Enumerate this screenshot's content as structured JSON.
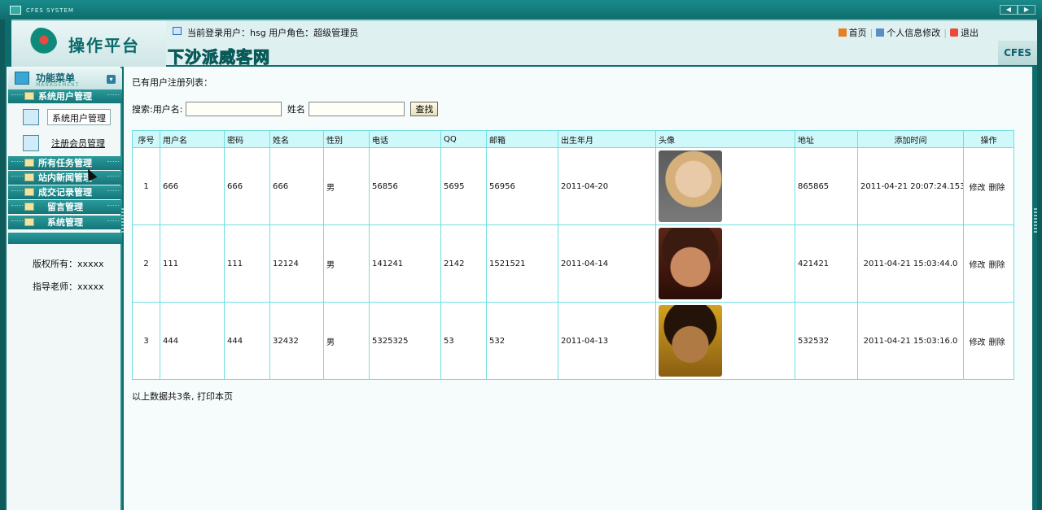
{
  "window": {
    "app_title": "CFES SYSTEM",
    "nav_prev": "◀",
    "nav_next": "▶"
  },
  "header": {
    "logo_text": "操作平台",
    "site_name": "下沙派威客网",
    "user_info": "当前登录用户：hsg  用户角色：超级管理员",
    "links": {
      "home": "首页",
      "profile": "个人信息修改",
      "logout": "退出"
    },
    "badge": "CFES"
  },
  "sidebar": {
    "menu_title": "功能菜单",
    "menu_subtitle": "MANAGEMENT",
    "collapse_glyph": "▾",
    "items": [
      {
        "label": "系统用户管理"
      },
      {
        "label": "所有任务管理"
      },
      {
        "label": "站内新闻管理"
      },
      {
        "label": "成交记录管理"
      },
      {
        "label": "留言管理"
      },
      {
        "label": "系统管理"
      }
    ],
    "sub_items": [
      {
        "label": "系统用户管理"
      },
      {
        "label": "注册会员管理"
      }
    ],
    "copyright": "版权所有：xxxxx",
    "teacher": "指导老师：xxxxx"
  },
  "main": {
    "heading": "已有用户注册列表：",
    "search": {
      "username_label": "搜索:用户名:",
      "username_value": "",
      "name_label": "姓名",
      "name_value": "",
      "button": "查找"
    },
    "table": {
      "headers": [
        "序号",
        "用户名",
        "密码",
        "姓名",
        "性别",
        "电话",
        "QQ",
        "邮箱",
        "出生年月",
        "头像",
        "地址",
        "添加时间",
        "操作"
      ],
      "rows": [
        {
          "no": "1",
          "username": "666",
          "password": "666",
          "name": "666",
          "gender": "男",
          "phone": "56856",
          "qq": "5695",
          "email": "56956",
          "birth": "2011-04-20",
          "address": "865865",
          "added": "2011-04-21 20:07:24.153",
          "edit": "修改",
          "delete": "删除"
        },
        {
          "no": "2",
          "username": "111",
          "password": "111",
          "name": "12124",
          "gender": "男",
          "phone": "141241",
          "qq": "2142",
          "email": "1521521",
          "birth": "2011-04-14",
          "address": "421421",
          "added": "2011-04-21 15:03:44.0",
          "edit": "修改",
          "delete": "删除"
        },
        {
          "no": "3",
          "username": "444",
          "password": "444",
          "name": "32432",
          "gender": "男",
          "phone": "5325325",
          "qq": "53",
          "email": "532",
          "birth": "2011-04-13",
          "address": "532532",
          "added": "2011-04-21 15:03:16.0",
          "edit": "修改",
          "delete": "删除"
        }
      ]
    },
    "summary": "以上数据共3条, 打印本页"
  }
}
